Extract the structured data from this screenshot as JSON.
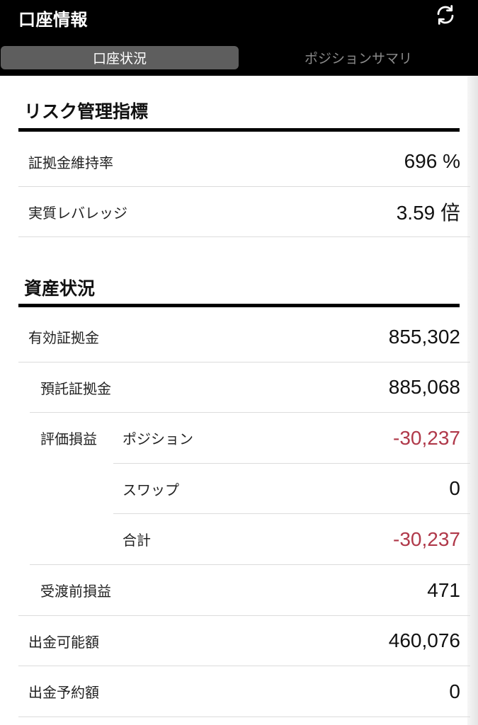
{
  "header": {
    "title": "口座情報",
    "refresh_icon": "refresh-icon"
  },
  "tabs": [
    {
      "label": "口座状況",
      "active": true
    },
    {
      "label": "ポジションサマリ",
      "active": false
    }
  ],
  "risk": {
    "title": "リスク管理指標",
    "rows": [
      {
        "label": "証拠金維持率",
        "value": "696 %"
      },
      {
        "label": "実質レバレッジ",
        "value": "3.59 倍"
      }
    ]
  },
  "assets": {
    "title": "資産状況",
    "effective_margin": {
      "label": "有効証拠金",
      "value": "855,302"
    },
    "deposit_margin": {
      "label": "預託証拠金",
      "value": "885,068"
    },
    "valuation": {
      "label": "評価損益",
      "position": {
        "label": "ポジション",
        "value": "-30,237"
      },
      "swap": {
        "label": "スワップ",
        "value": "0"
      },
      "total": {
        "label": "合計",
        "value": "-30,237"
      }
    },
    "unsettled_pl": {
      "label": "受渡前損益",
      "value": "471"
    },
    "withdrawable": {
      "label": "出金可能額",
      "value": "460,076"
    },
    "withdraw_reserved": {
      "label": "出金予約額",
      "value": "0"
    }
  },
  "colors": {
    "negative": "#b0394a",
    "header_bg": "#000000",
    "active_tab_bg": "#5e5e5e"
  }
}
